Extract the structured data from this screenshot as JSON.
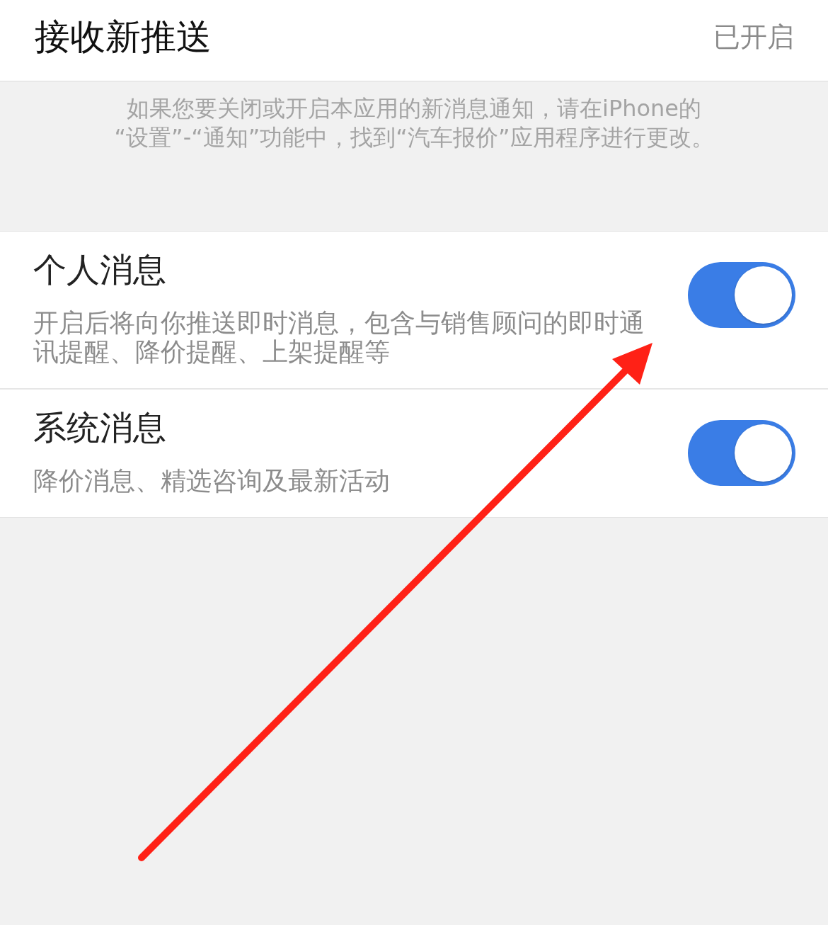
{
  "header": {
    "title": "接收新推送",
    "value": "已开启"
  },
  "hint": "如果您要关闭或开启本应用的新消息通知，请在iPhone的\n“设置”-“通知”功能中，找到“汽车报价”应用程序进行更改。",
  "rows": [
    {
      "title": "个人消息",
      "description": "开启后将向你推送即时消息，包含与销售顾问的即时通讯提醒、降价提醒、上架提醒等",
      "on": true
    },
    {
      "title": "系统消息",
      "description": "降价消息、精选咨询及最新活动",
      "on": true
    }
  ],
  "annotation": {
    "kind": "arrow"
  }
}
